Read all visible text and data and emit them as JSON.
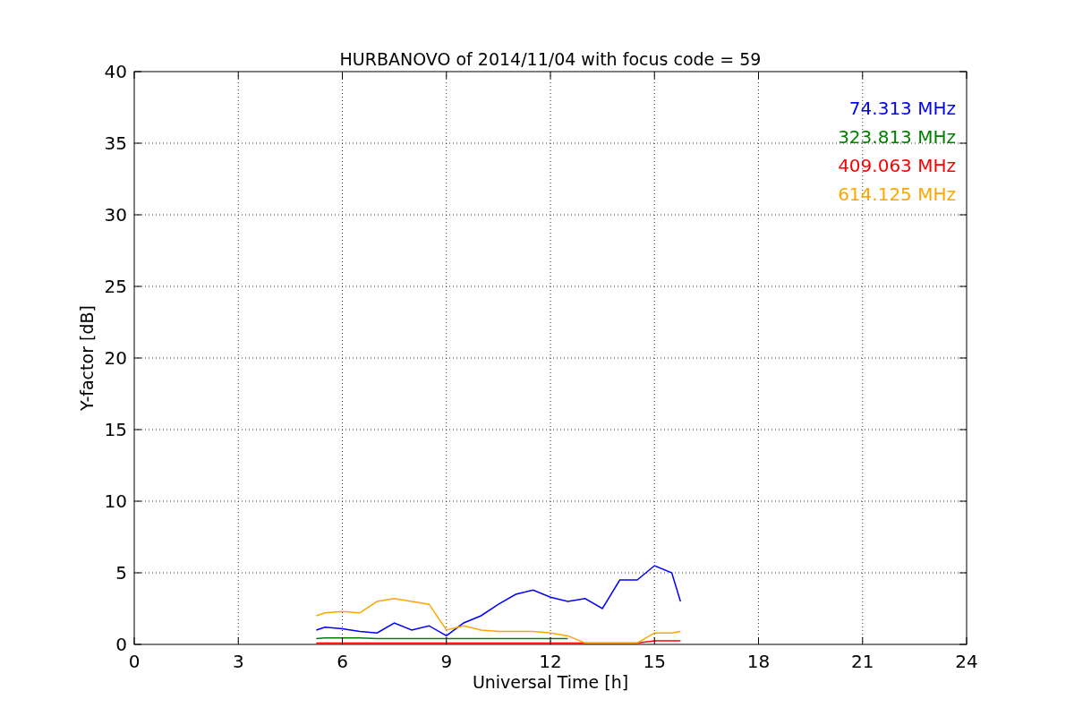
{
  "chart_data": {
    "type": "line",
    "title": "HURBANOVO of 2014/11/04 with focus code = 59",
    "xlabel": "Universal Time [h]",
    "ylabel": "Y-factor [dB]",
    "x": [
      5.25,
      5.5,
      6,
      6.5,
      7,
      7.5,
      8,
      8.5,
      9,
      9.5,
      10,
      10.5,
      11,
      11.5,
      12,
      12.5,
      13,
      13.5,
      14,
      14.5,
      15,
      15.5,
      15.75
    ],
    "series": [
      {
        "name": "74.313 MHz",
        "color": "#0000ff",
        "values": [
          1.0,
          1.2,
          1.1,
          0.9,
          0.8,
          1.5,
          1.0,
          1.3,
          0.6,
          1.5,
          2.0,
          2.8,
          3.5,
          3.8,
          3.3,
          3.0,
          3.2,
          2.5,
          4.5,
          4.5,
          5.5,
          5.0,
          3.0
        ]
      },
      {
        "name": "323.813 MHz",
        "color": "#008000",
        "values": [
          0.4,
          0.45,
          0.45,
          0.45,
          0.4,
          0.4,
          0.4,
          0.4,
          0.4,
          0.4,
          0.4,
          0.4,
          0.4,
          0.4,
          0.4,
          0.4,
          null,
          null,
          null,
          null,
          null,
          null,
          null
        ]
      },
      {
        "name": "409.063 MHz",
        "color": "#ff0000",
        "values": [
          0.1,
          0.1,
          0.1,
          0.1,
          0.1,
          0.1,
          0.1,
          0.1,
          0.1,
          0.1,
          0.1,
          0.1,
          0.1,
          0.1,
          0.1,
          0.1,
          0.1,
          0.1,
          0.1,
          0.1,
          0.25,
          0.25,
          0.25
        ]
      },
      {
        "name": "614.125 MHz",
        "color": "#ffa500",
        "values": [
          2.0,
          2.2,
          2.3,
          2.2,
          3.0,
          3.2,
          3.0,
          2.8,
          1.0,
          1.3,
          1.0,
          0.9,
          0.9,
          0.9,
          0.8,
          0.6,
          0.1,
          0.1,
          0.1,
          0.1,
          0.8,
          0.8,
          0.9
        ]
      }
    ],
    "grid": true,
    "xlim": [
      0,
      24
    ],
    "ylim": [
      0,
      40
    ],
    "xticks": [
      0,
      3,
      6,
      9,
      12,
      15,
      18,
      21,
      24
    ],
    "yticks": [
      0,
      5,
      10,
      15,
      20,
      25,
      30,
      35,
      40
    ]
  }
}
